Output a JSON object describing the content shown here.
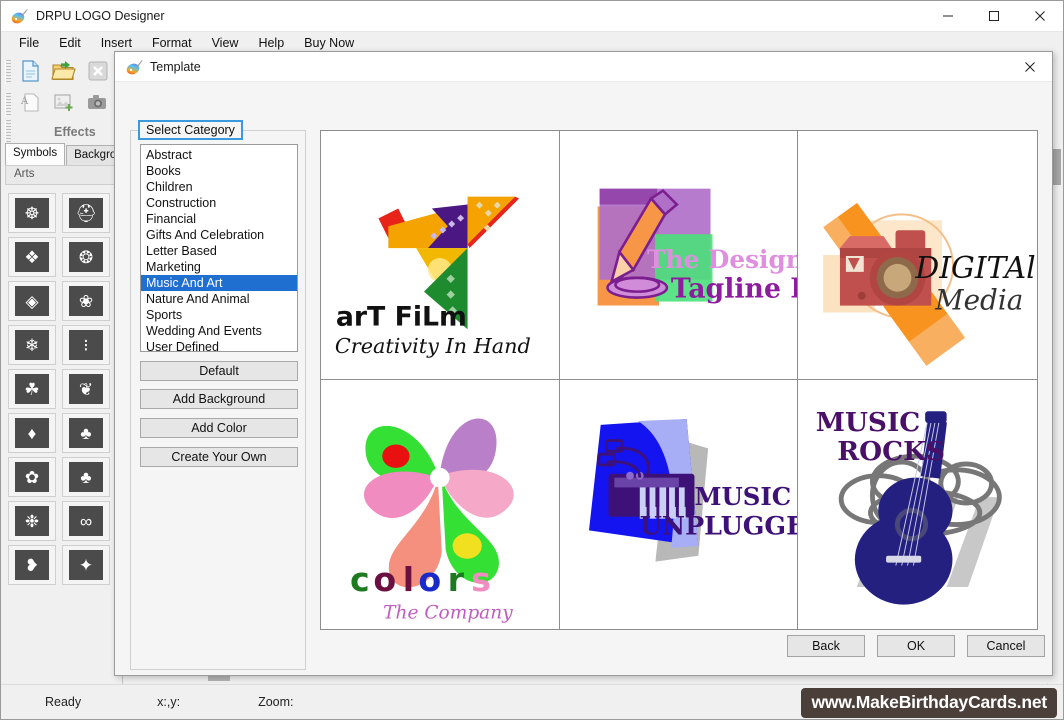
{
  "window": {
    "title": "DRPU LOGO Designer",
    "icon": "logo-palette-icon",
    "controls": {
      "minimize": "–",
      "maximize": "▢",
      "close": "✕"
    }
  },
  "menubar": {
    "items": [
      "File",
      "Edit",
      "Insert",
      "Format",
      "View",
      "Help",
      "Buy Now"
    ]
  },
  "toolbar": {
    "row1_icons": [
      "new-document-icon",
      "open-folder-icon",
      "close-document-icon"
    ],
    "row2_icons": [
      "insert-text-icon",
      "insert-image-icon",
      "capture-camera-icon"
    ],
    "effects_label": "Effects"
  },
  "left_panel": {
    "tabs": [
      {
        "label": "Symbols",
        "active": true
      },
      {
        "label": "Background",
        "active": false
      }
    ],
    "section_header": "Arts",
    "symbols": [
      "triskelion-symbol",
      "celtic-knot-wheel-symbol",
      "square-interlace-symbol",
      "diamond-cross-symbol",
      "circle-weave-symbol",
      "quatrefoil-spiral-symbol",
      "floral-cross-symbol",
      "scatter-dots-symbol",
      "fan-crest-symbol",
      "leaf-scroll-symbol",
      "diamond-fleur-symbol",
      "palmette-fan-symbol",
      "diamond-shell-symbol",
      "oak-tree-symbol",
      "rosette-symbol",
      "scroll-divider-symbol",
      "heart-crest-symbol",
      "abstract-blade-symbol"
    ]
  },
  "statusbar": {
    "ready": "Ready",
    "coords_label": "x:,y:",
    "zoom_label": "Zoom:",
    "watermark": "www.MakeBirthdayCards.net"
  },
  "dialog": {
    "title": "Template",
    "icon": "logo-palette-icon",
    "close": "✕",
    "group_legend": "Select Category",
    "categories": [
      {
        "label": "Abstract",
        "selected": false
      },
      {
        "label": "Books",
        "selected": false
      },
      {
        "label": "Children",
        "selected": false
      },
      {
        "label": "Construction",
        "selected": false
      },
      {
        "label": "Financial",
        "selected": false
      },
      {
        "label": "Gifts And Celebration",
        "selected": false
      },
      {
        "label": "Letter Based",
        "selected": false
      },
      {
        "label": "Marketing",
        "selected": false
      },
      {
        "label": "Music And Art",
        "selected": true
      },
      {
        "label": "Nature And Animal",
        "selected": false
      },
      {
        "label": "Sports",
        "selected": false
      },
      {
        "label": "Wedding And Events",
        "selected": false
      },
      {
        "label": "User Defined",
        "selected": false
      }
    ],
    "side_buttons": [
      "Default",
      "Add Background",
      "Add Color",
      "Create Your Own"
    ],
    "templates": [
      {
        "name": "art-film-template",
        "title": "arT FiLm",
        "tagline": "Creativity In Hand",
        "graphic": "origami-bird-icon",
        "colors": {
          "orange": "#F5A300",
          "purple": "#4B1783",
          "green": "#1E8C2E",
          "red": "#E8231A",
          "gold": "#F2B800"
        }
      },
      {
        "name": "design-bag-template",
        "title": "The Design Bag",
        "tagline": "Tagline Here",
        "graphic": "pencil-icon",
        "colors": {
          "orange": "#F79646",
          "purple": "#A35CC0",
          "green": "#4BE07A",
          "ink": "#7B1E8F",
          "titlepink": "#E08FE0"
        }
      },
      {
        "name": "digital-media-template",
        "title": "DIGITAl",
        "tagline": "Media",
        "graphic": "camera-icon",
        "colors": {
          "orange": "#F7931E",
          "lightorange": "#F8B060",
          "cream": "#FBE3C2",
          "camera": "#C0504D"
        }
      },
      {
        "name": "colors-company-template",
        "title": "colors",
        "tagline": "The Company",
        "graphic": "flower-petals-icon",
        "colors": {
          "green": "#33E033",
          "pink": "#F08CC0",
          "purple": "#B97FC8",
          "salmon": "#F5907F",
          "yellow": "#F0E020",
          "red": "#E81010"
        }
      },
      {
        "name": "music-unplugged-template",
        "title": "MUSIC",
        "tagline": "UNPLUGGED",
        "graphic": "keyboard-piano-icon",
        "colors": {
          "blue": "#1414F0",
          "lavender": "#A8AEF5",
          "gray": "#B8B8B8",
          "purple": "#3D1178"
        }
      },
      {
        "name": "music-rocks-template",
        "title": "MUSIC",
        "tagline": "ROCKS",
        "graphic": "guitar-icon",
        "colors": {
          "navy": "#242080",
          "gray": "#777777",
          "lightgray": "#C8C8C8",
          "purple": "#4A1068"
        }
      }
    ],
    "footer_buttons": [
      {
        "label": "Back",
        "name": "back-button"
      },
      {
        "label": "OK",
        "name": "ok-button"
      },
      {
        "label": "Cancel",
        "name": "cancel-button"
      }
    ]
  }
}
